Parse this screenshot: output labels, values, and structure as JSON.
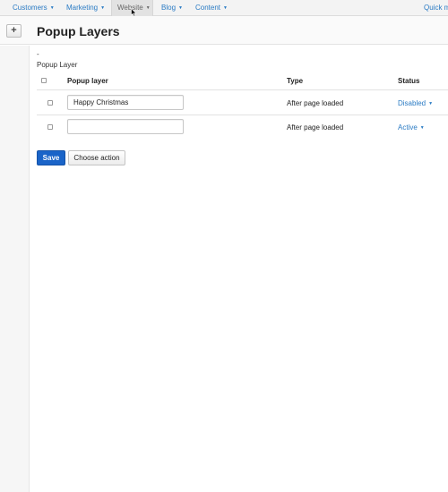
{
  "nav": {
    "items": [
      {
        "label": "Customers"
      },
      {
        "label": "Marketing"
      },
      {
        "label": "Website"
      },
      {
        "label": "Blog"
      },
      {
        "label": "Content"
      }
    ],
    "quick": "Quick m"
  },
  "header": {
    "add_label": "+",
    "title": "Popup Layers"
  },
  "content": {
    "dash": "-",
    "section_title": "Popup Layer",
    "columns": {
      "name": "Popup layer",
      "type": "Type",
      "status": "Status"
    },
    "rows": [
      {
        "name": "Happy Christmas",
        "type": "After page loaded",
        "status": "Disabled"
      },
      {
        "name": "",
        "type": "After page loaded",
        "status": "Active"
      }
    ]
  },
  "actions": {
    "save": "Save",
    "choose": "Choose action"
  },
  "colors": {
    "link": "#2a7bc4",
    "primary": "#1a64c8"
  }
}
